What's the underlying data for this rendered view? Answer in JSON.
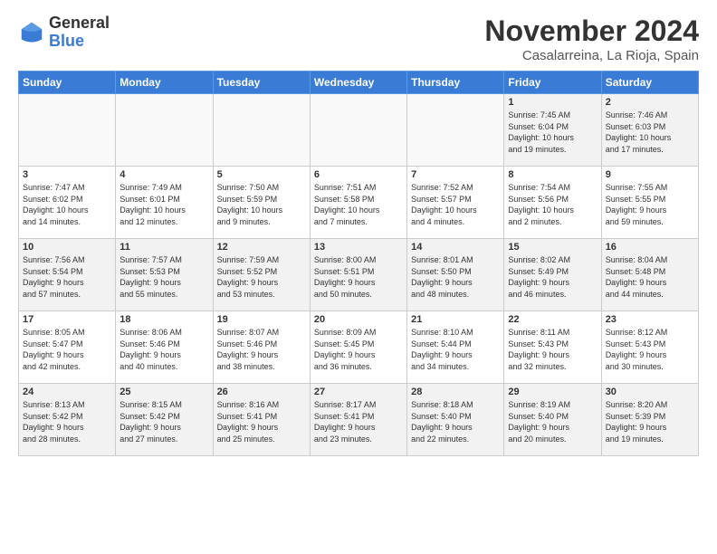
{
  "logo": {
    "general": "General",
    "blue": "Blue"
  },
  "title": "November 2024",
  "subtitle": "Casalarreina, La Rioja, Spain",
  "days_of_week": [
    "Sunday",
    "Monday",
    "Tuesday",
    "Wednesday",
    "Thursday",
    "Friday",
    "Saturday"
  ],
  "weeks": [
    [
      {
        "day": "",
        "info": "",
        "empty": true
      },
      {
        "day": "",
        "info": "",
        "empty": true
      },
      {
        "day": "",
        "info": "",
        "empty": true
      },
      {
        "day": "",
        "info": "",
        "empty": true
      },
      {
        "day": "",
        "info": "",
        "empty": true
      },
      {
        "day": "1",
        "info": "Sunrise: 7:45 AM\nSunset: 6:04 PM\nDaylight: 10 hours\nand 19 minutes."
      },
      {
        "day": "2",
        "info": "Sunrise: 7:46 AM\nSunset: 6:03 PM\nDaylight: 10 hours\nand 17 minutes."
      }
    ],
    [
      {
        "day": "3",
        "info": "Sunrise: 7:47 AM\nSunset: 6:02 PM\nDaylight: 10 hours\nand 14 minutes."
      },
      {
        "day": "4",
        "info": "Sunrise: 7:49 AM\nSunset: 6:01 PM\nDaylight: 10 hours\nand 12 minutes."
      },
      {
        "day": "5",
        "info": "Sunrise: 7:50 AM\nSunset: 5:59 PM\nDaylight: 10 hours\nand 9 minutes."
      },
      {
        "day": "6",
        "info": "Sunrise: 7:51 AM\nSunset: 5:58 PM\nDaylight: 10 hours\nand 7 minutes."
      },
      {
        "day": "7",
        "info": "Sunrise: 7:52 AM\nSunset: 5:57 PM\nDaylight: 10 hours\nand 4 minutes."
      },
      {
        "day": "8",
        "info": "Sunrise: 7:54 AM\nSunset: 5:56 PM\nDaylight: 10 hours\nand 2 minutes."
      },
      {
        "day": "9",
        "info": "Sunrise: 7:55 AM\nSunset: 5:55 PM\nDaylight: 9 hours\nand 59 minutes."
      }
    ],
    [
      {
        "day": "10",
        "info": "Sunrise: 7:56 AM\nSunset: 5:54 PM\nDaylight: 9 hours\nand 57 minutes."
      },
      {
        "day": "11",
        "info": "Sunrise: 7:57 AM\nSunset: 5:53 PM\nDaylight: 9 hours\nand 55 minutes."
      },
      {
        "day": "12",
        "info": "Sunrise: 7:59 AM\nSunset: 5:52 PM\nDaylight: 9 hours\nand 53 minutes."
      },
      {
        "day": "13",
        "info": "Sunrise: 8:00 AM\nSunset: 5:51 PM\nDaylight: 9 hours\nand 50 minutes."
      },
      {
        "day": "14",
        "info": "Sunrise: 8:01 AM\nSunset: 5:50 PM\nDaylight: 9 hours\nand 48 minutes."
      },
      {
        "day": "15",
        "info": "Sunrise: 8:02 AM\nSunset: 5:49 PM\nDaylight: 9 hours\nand 46 minutes."
      },
      {
        "day": "16",
        "info": "Sunrise: 8:04 AM\nSunset: 5:48 PM\nDaylight: 9 hours\nand 44 minutes."
      }
    ],
    [
      {
        "day": "17",
        "info": "Sunrise: 8:05 AM\nSunset: 5:47 PM\nDaylight: 9 hours\nand 42 minutes."
      },
      {
        "day": "18",
        "info": "Sunrise: 8:06 AM\nSunset: 5:46 PM\nDaylight: 9 hours\nand 40 minutes."
      },
      {
        "day": "19",
        "info": "Sunrise: 8:07 AM\nSunset: 5:46 PM\nDaylight: 9 hours\nand 38 minutes."
      },
      {
        "day": "20",
        "info": "Sunrise: 8:09 AM\nSunset: 5:45 PM\nDaylight: 9 hours\nand 36 minutes."
      },
      {
        "day": "21",
        "info": "Sunrise: 8:10 AM\nSunset: 5:44 PM\nDaylight: 9 hours\nand 34 minutes."
      },
      {
        "day": "22",
        "info": "Sunrise: 8:11 AM\nSunset: 5:43 PM\nDaylight: 9 hours\nand 32 minutes."
      },
      {
        "day": "23",
        "info": "Sunrise: 8:12 AM\nSunset: 5:43 PM\nDaylight: 9 hours\nand 30 minutes."
      }
    ],
    [
      {
        "day": "24",
        "info": "Sunrise: 8:13 AM\nSunset: 5:42 PM\nDaylight: 9 hours\nand 28 minutes."
      },
      {
        "day": "25",
        "info": "Sunrise: 8:15 AM\nSunset: 5:42 PM\nDaylight: 9 hours\nand 27 minutes."
      },
      {
        "day": "26",
        "info": "Sunrise: 8:16 AM\nSunset: 5:41 PM\nDaylight: 9 hours\nand 25 minutes."
      },
      {
        "day": "27",
        "info": "Sunrise: 8:17 AM\nSunset: 5:41 PM\nDaylight: 9 hours\nand 23 minutes."
      },
      {
        "day": "28",
        "info": "Sunrise: 8:18 AM\nSunset: 5:40 PM\nDaylight: 9 hours\nand 22 minutes."
      },
      {
        "day": "29",
        "info": "Sunrise: 8:19 AM\nSunset: 5:40 PM\nDaylight: 9 hours\nand 20 minutes."
      },
      {
        "day": "30",
        "info": "Sunrise: 8:20 AM\nSunset: 5:39 PM\nDaylight: 9 hours\nand 19 minutes."
      }
    ]
  ]
}
